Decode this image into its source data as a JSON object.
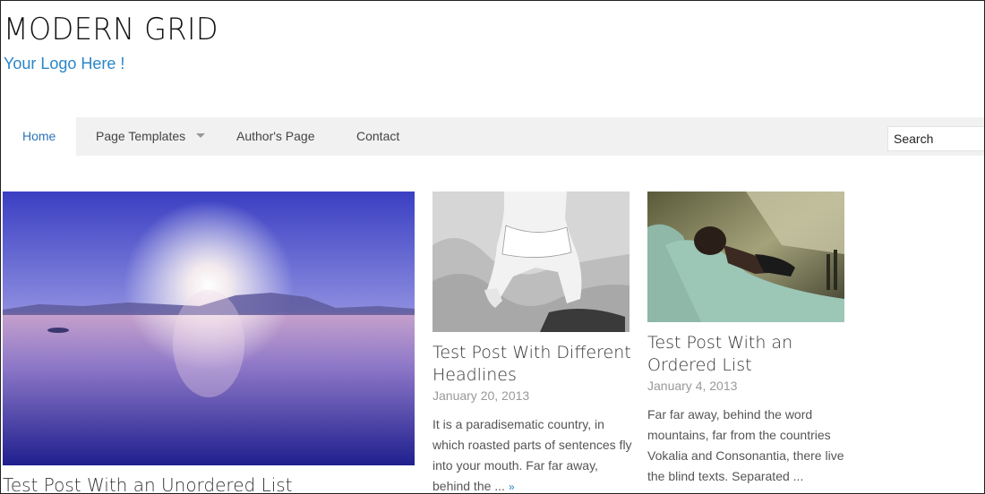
{
  "site": {
    "title": "MODERN GRID",
    "tagline": "Your Logo Here !"
  },
  "nav": {
    "items": [
      {
        "label": "Home",
        "active": true
      },
      {
        "label": "Page Templates",
        "has_dropdown": true
      },
      {
        "label": "Author's Page"
      },
      {
        "label": "Contact"
      }
    ]
  },
  "search": {
    "placeholder": "Search"
  },
  "posts": [
    {
      "title": "Test Post With an Unordered List",
      "image": "sunrise-lake-image"
    },
    {
      "title": "Test Post With Different Headlines",
      "date": "January 20, 2013",
      "excerpt": "It is a paradisematic country, in which roasted parts of sentences fly into your mouth. Far far away, behind the ...",
      "read_more": "»",
      "image": "kneeling-woman-bw-image"
    },
    {
      "title": "Test Post With an Ordered List",
      "date": "January 4, 2013",
      "excerpt": "Far far away, behind the word mountains, far from the countries Vokalia and Consonantia, there live the blind texts. Separated ...",
      "image": "woman-lying-bed-image"
    }
  ],
  "colors": {
    "accent": "#2a86c9",
    "nav_bg": "#f1f1f2",
    "date": "#999999"
  }
}
